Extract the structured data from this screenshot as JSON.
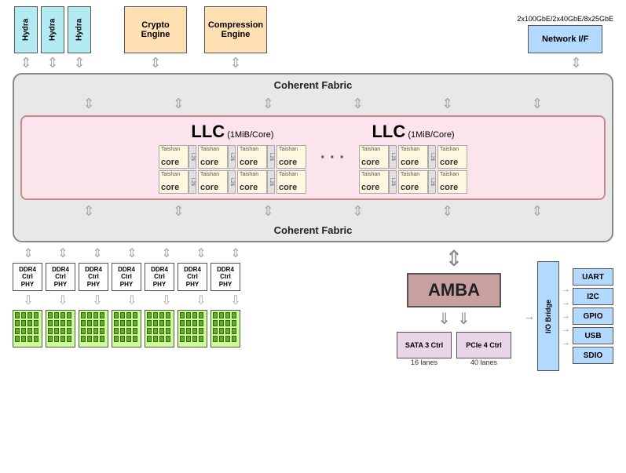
{
  "hydra": {
    "blocks": [
      "Hydra",
      "Hydra",
      "Hydra"
    ]
  },
  "crypto": {
    "label": "Crypto Engine"
  },
  "compression": {
    "label": "Compression Engine"
  },
  "network": {
    "speeds": "2x100GbE/2x40GbE/8x25GbE",
    "label": "Network I/F"
  },
  "coherent_fabric_top": "Coherent Fabric",
  "coherent_fabric_bottom": "Coherent Fabric",
  "llc": {
    "title": "LLC",
    "sub": "(1MiB/Core)"
  },
  "cores": [
    {
      "label": "Taishan\ncore"
    },
    {
      "label": "Taishan\ncore"
    },
    {
      "label": "Taishan\ncore"
    },
    {
      "label": "Taishan\ncore"
    },
    {
      "label": "Taishan\ncore"
    },
    {
      "label": "Taishan\ncore"
    },
    {
      "label": "Taishan\ncore"
    },
    {
      "label": "Taishan\ncore"
    }
  ],
  "ddr_ctrls": [
    "DDR4\nCtrl\nPHY",
    "DDR4\nCtrl\nPHY",
    "DDR4\nCtrl\nPHY",
    "DDR4\nCtrl\nPHY",
    "DDR4\nCtrl\nPHY",
    "DDR4\nCtrl\nPHY",
    "DDR4\nCtrl\nPHY"
  ],
  "amba": {
    "label": "AMBA"
  },
  "sata": {
    "label": "SATA 3 Ctrl",
    "lanes": "16 lanes"
  },
  "pcie": {
    "label": "PCIe 4 Ctrl",
    "lanes": "40 lanes"
  },
  "io_bridge": {
    "label": "I/O Bridge"
  },
  "peripherals": [
    "UART",
    "I2C",
    "GPIO",
    "USB",
    "SDIO"
  ]
}
